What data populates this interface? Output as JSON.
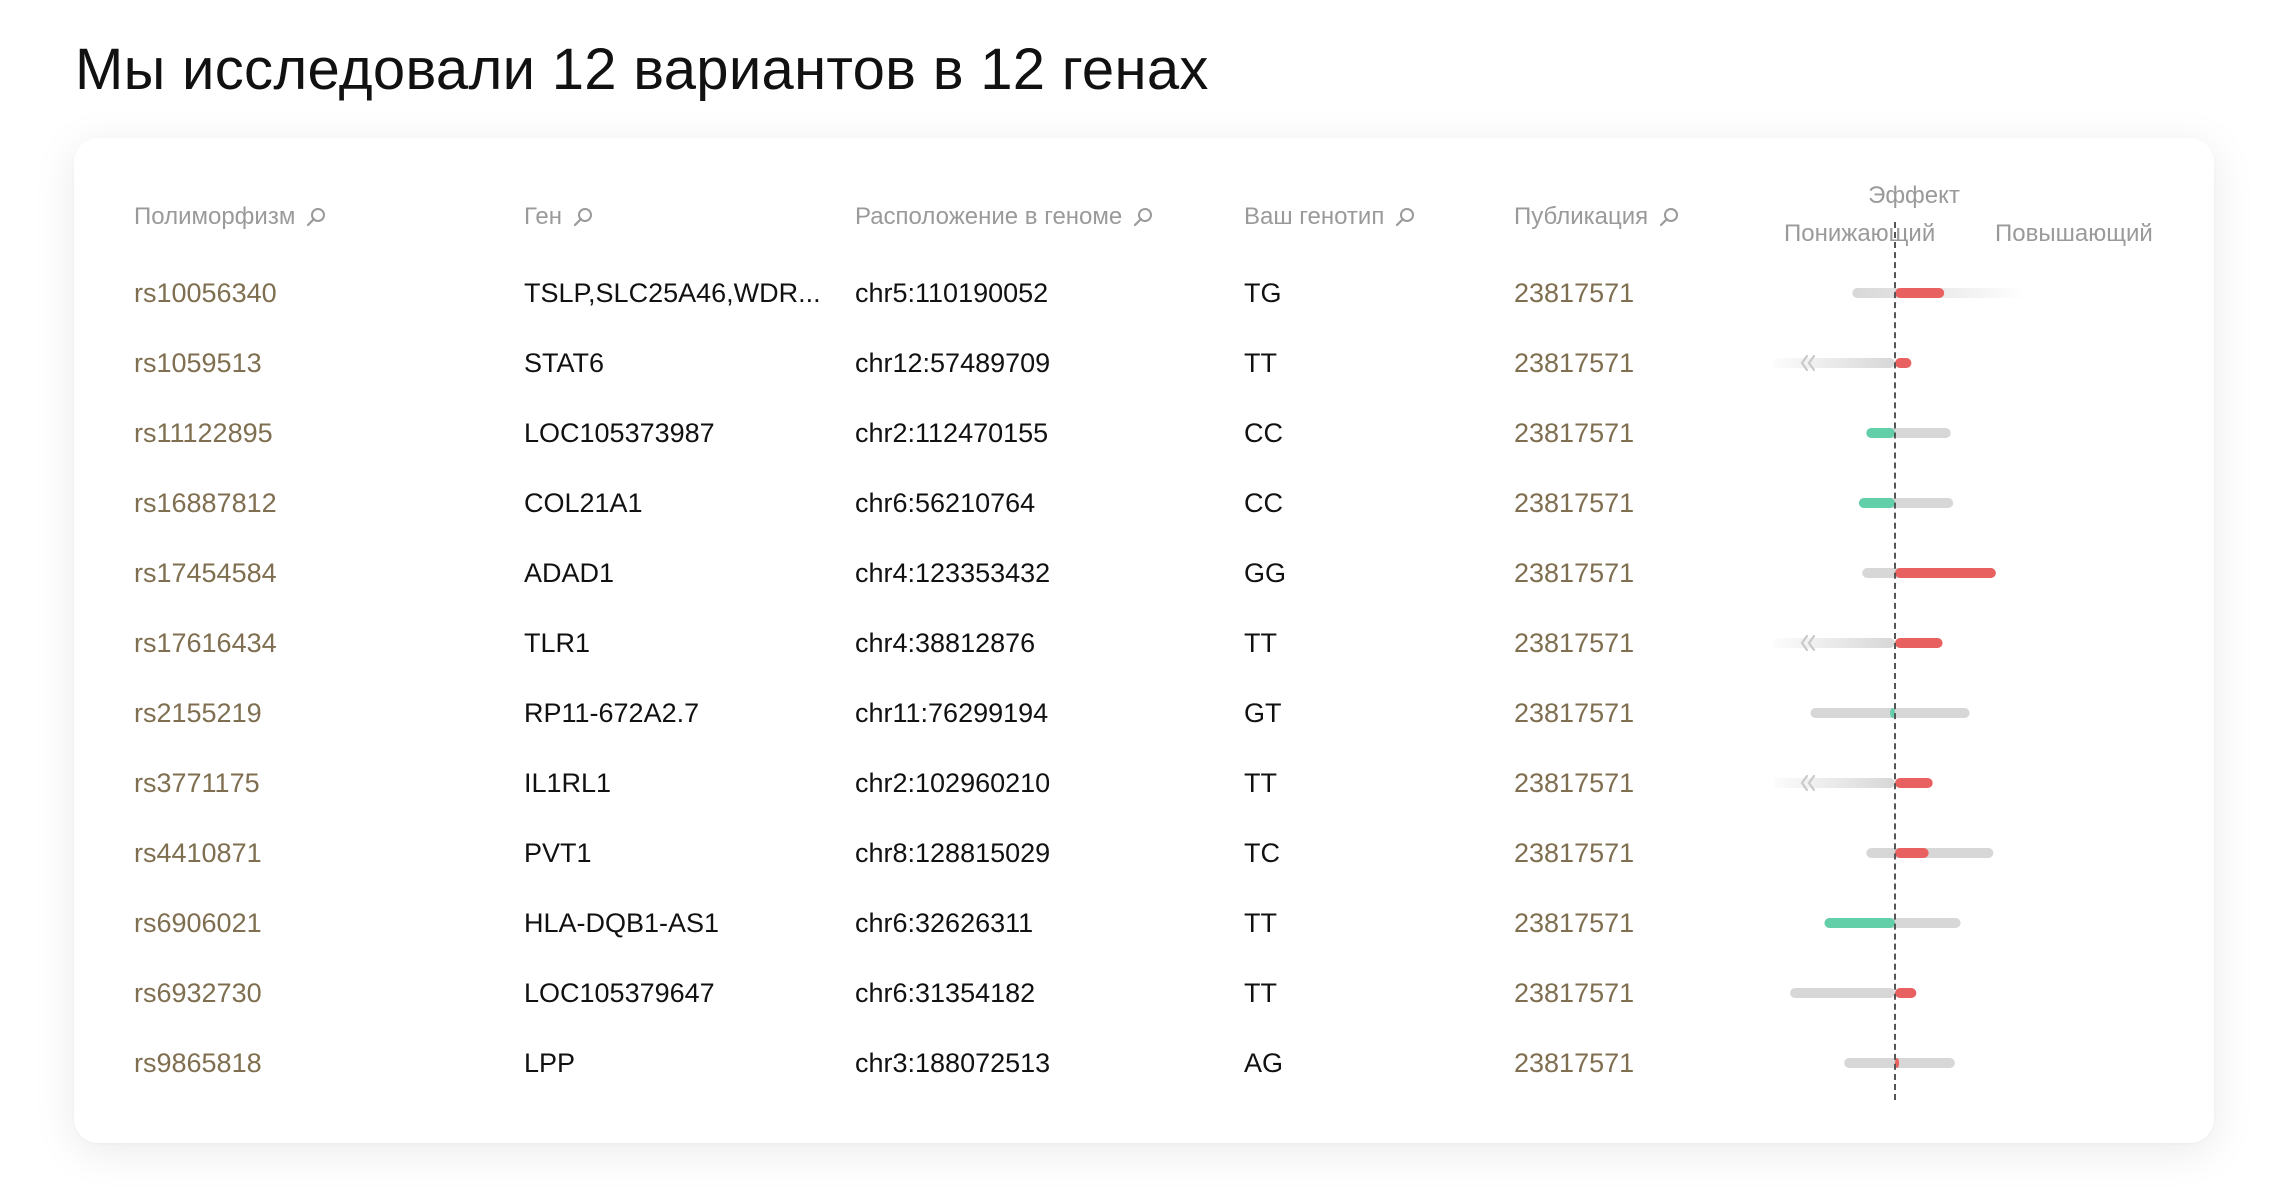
{
  "title": "Мы исследовали 12 вариантов в 12 генах",
  "columns": {
    "polymorphism": "Полиморфизм",
    "gene": "Ген",
    "location": "Расположение в геноме",
    "genotype": "Ваш генотип",
    "publication": "Публикация",
    "effect": "Эффект",
    "effect_decreasing": "Понижающий",
    "effect_increasing": "Повышающий"
  },
  "colors": {
    "increase": "#e8605f",
    "decrease": "#63cfa8",
    "range": "#d7d7d7",
    "link": "#7f6f50"
  },
  "icons": {
    "sort_search": "search-icon",
    "overflow_left": "double-chevron-left-icon",
    "overflow_right": "double-chevron-right-icon"
  },
  "rows": [
    {
      "rs": "rs10056340",
      "gene": "TSLP,SLC25A46,WDR...",
      "location": "chr5:110190052",
      "genotype": "TG",
      "pub": "23817571",
      "range": [
        -0.52,
        1.6
      ],
      "effect": 0.6,
      "overflow_left": false,
      "overflow_right": true
    },
    {
      "rs": "rs1059513",
      "gene": "STAT6",
      "location": "chr12:57489709",
      "genotype": "TT",
      "pub": "23817571",
      "range": [
        -1.6,
        0
      ],
      "effect": 0.2,
      "overflow_left": true,
      "overflow_right": false
    },
    {
      "rs": "rs11122895",
      "gene": "LOC105373987",
      "location": "chr2:112470155",
      "genotype": "CC",
      "pub": "23817571",
      "range": [
        -0.35,
        0.68
      ],
      "effect": -0.35,
      "overflow_left": false,
      "overflow_right": false
    },
    {
      "rs": "rs16887812",
      "gene": "COL21A1",
      "location": "chr6:56210764",
      "genotype": "CC",
      "pub": "23817571",
      "range": [
        -0.44,
        0.71
      ],
      "effect": -0.44,
      "overflow_left": false,
      "overflow_right": false
    },
    {
      "rs": "rs17454584",
      "gene": "ADAD1",
      "location": "chr4:123353432",
      "genotype": "GG",
      "pub": "23817571",
      "range": [
        -0.4,
        1.23
      ],
      "effect": 1.23,
      "overflow_left": false,
      "overflow_right": false
    },
    {
      "rs": "rs17616434",
      "gene": "TLR1",
      "location": "chr4:38812876",
      "genotype": "TT",
      "pub": "23817571",
      "range": [
        -1.6,
        0
      ],
      "effect": 0.58,
      "overflow_left": true,
      "overflow_right": false
    },
    {
      "rs": "rs2155219",
      "gene": "RP11-672A2.7",
      "location": "chr11:76299194",
      "genotype": "GT",
      "pub": "23817571",
      "range": [
        -1.03,
        0.91
      ],
      "effect": -0.06,
      "overflow_left": false,
      "overflow_right": false
    },
    {
      "rs": "rs3771175",
      "gene": "IL1RL1",
      "location": "chr2:102960210",
      "genotype": "TT",
      "pub": "23817571",
      "range": [
        -1.6,
        0
      ],
      "effect": 0.46,
      "overflow_left": true,
      "overflow_right": false
    },
    {
      "rs": "rs4410871",
      "gene": "PVT1",
      "location": "chr8:128815029",
      "genotype": "TC",
      "pub": "23817571",
      "range": [
        -0.35,
        1.2
      ],
      "effect": 0.41,
      "overflow_left": false,
      "overflow_right": false
    },
    {
      "rs": "rs6906021",
      "gene": "HLA-DQB1-AS1",
      "location": "chr6:32626311",
      "genotype": "TT",
      "pub": "23817571",
      "range": [
        -0.86,
        0.8
      ],
      "effect": -0.86,
      "overflow_left": false,
      "overflow_right": false
    },
    {
      "rs": "rs6932730",
      "gene": "LOC105379647",
      "location": "chr6:31354182",
      "genotype": "TT",
      "pub": "23817571",
      "range": [
        -1.28,
        0
      ],
      "effect": 0.26,
      "overflow_left": false,
      "overflow_right": false
    },
    {
      "rs": "rs9865818",
      "gene": "LPP",
      "location": "chr3:188072513",
      "genotype": "AG",
      "pub": "23817571",
      "range": [
        -0.62,
        0.73
      ],
      "effect": 0.05,
      "overflow_left": false,
      "overflow_right": false
    }
  ]
}
